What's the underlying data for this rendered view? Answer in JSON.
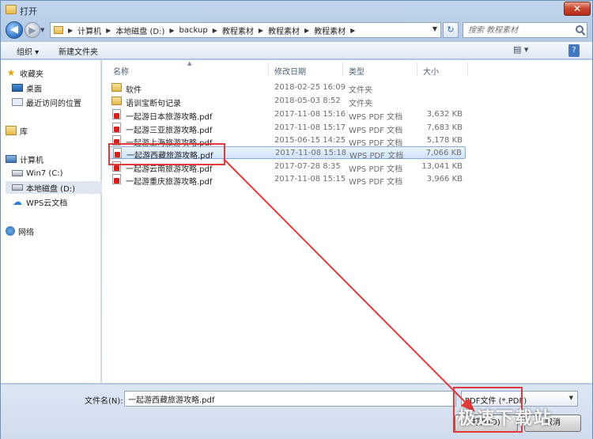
{
  "window": {
    "title": "打开",
    "close_glyph": "✕"
  },
  "nav": {
    "back_glyph": "◀",
    "forward_glyph": "▶",
    "breadcrumb": [
      "计算机",
      "本地磁盘 (D:)",
      "backup",
      "教程素材",
      "教程素材",
      "教程素材"
    ],
    "refresh_glyph": "↻",
    "search_placeholder": "搜索 教程素材"
  },
  "toolbar": {
    "organize": "组织 ▾",
    "new_folder": "新建文件夹",
    "view_glyph": "▤ ▾",
    "help_glyph": "?"
  },
  "sidebar": {
    "items": [
      {
        "label": "收藏夹",
        "icon": "star-icon"
      },
      {
        "label": "桌面",
        "icon": "desktop-icon"
      },
      {
        "label": "最近访问的位置",
        "icon": "recent-places-icon"
      },
      {
        "label": "库",
        "icon": "library-icon"
      },
      {
        "label": "计算机",
        "icon": "computer-icon"
      },
      {
        "label": "Win7 (C:)",
        "icon": "drive-icon"
      },
      {
        "label": "本地磁盘 (D:)",
        "icon": "drive-icon",
        "selected": true
      },
      {
        "label": "WPS云文档",
        "icon": "cloud-icon"
      },
      {
        "label": "网络",
        "icon": "network-icon"
      }
    ]
  },
  "files": {
    "columns": {
      "name": "名称",
      "date": "修改日期",
      "type": "类型",
      "size": "大小"
    },
    "rows": [
      {
        "name": "软件",
        "date": "2018-02-25 16:09",
        "type": "文件夹",
        "size": "",
        "kind": "folder"
      },
      {
        "name": "语训宝断句记录",
        "date": "2018-05-03 8:52",
        "type": "文件夹",
        "size": "",
        "kind": "folder"
      },
      {
        "name": "一起游日本旅游攻略.pdf",
        "date": "2017-11-08 15:16",
        "type": "WPS PDF 文档",
        "size": "3,632 KB",
        "kind": "pdf"
      },
      {
        "name": "一起游三亚旅游攻略.pdf",
        "date": "2017-11-08 15:17",
        "type": "WPS PDF 文档",
        "size": "7,683 KB",
        "kind": "pdf"
      },
      {
        "name": "一起游上海旅游攻略.pdf",
        "date": "2015-06-15 14:25",
        "type": "WPS PDF 文档",
        "size": "5,178 KB",
        "kind": "pdf"
      },
      {
        "name": "一起游西藏旅游攻略.pdf",
        "date": "2017-11-08 15:18",
        "type": "WPS PDF 文档",
        "size": "7,066 KB",
        "kind": "pdf",
        "selected": true
      },
      {
        "name": "一起游云南旅游攻略.pdf",
        "date": "2017-07-28 8:35",
        "type": "WPS PDF 文档",
        "size": "13,041 KB",
        "kind": "pdf"
      },
      {
        "name": "一起游重庆旅游攻略.pdf",
        "date": "2017-11-08 15:15",
        "type": "WPS PDF 文档",
        "size": "3,966 KB",
        "kind": "pdf"
      }
    ]
  },
  "footer": {
    "filename_label": "文件名(N):",
    "filename_value": "一起游西藏旅游攻略.pdf",
    "filter_value": "PDF文件 (*.PDF)",
    "open_button": "打开(O)",
    "cancel_button": "取消"
  },
  "watermark": "极速下载站",
  "colors": {
    "highlight_box": "#e03a3a",
    "selection": "#cfe3fa"
  }
}
